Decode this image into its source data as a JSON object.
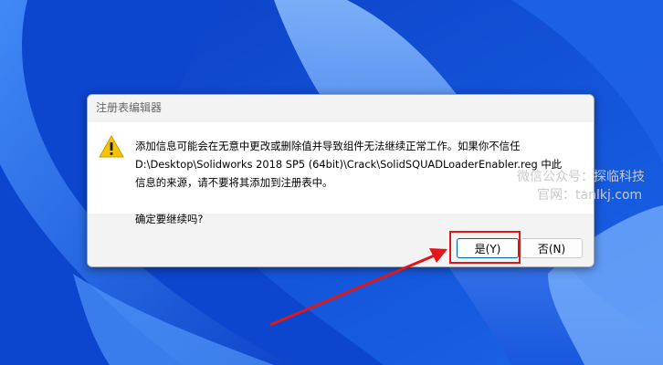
{
  "dialog": {
    "title": "注册表编辑器",
    "message_lines": [
      "添加信息可能会在无意中更改或删除值并导致组件无法继续正常工作。如果你不信任",
      "D:\\Desktop\\Solidworks 2018 SP5 (64bit)\\Crack\\SolidSQUADLoaderEnabler.reg 中此",
      "信息的来源，请不要将其添加到注册表中。"
    ],
    "question": "确定要继续吗?",
    "yes_label": "是(Y)",
    "no_label": "否(N)",
    "icon": "warning-icon"
  },
  "watermark": {
    "line1": "微信公众号：探临科技",
    "line2": "官网：tanlkj.com"
  },
  "colors": {
    "annotation": "#e11717",
    "accent": "#005fb8",
    "warning": "#f4c400"
  }
}
